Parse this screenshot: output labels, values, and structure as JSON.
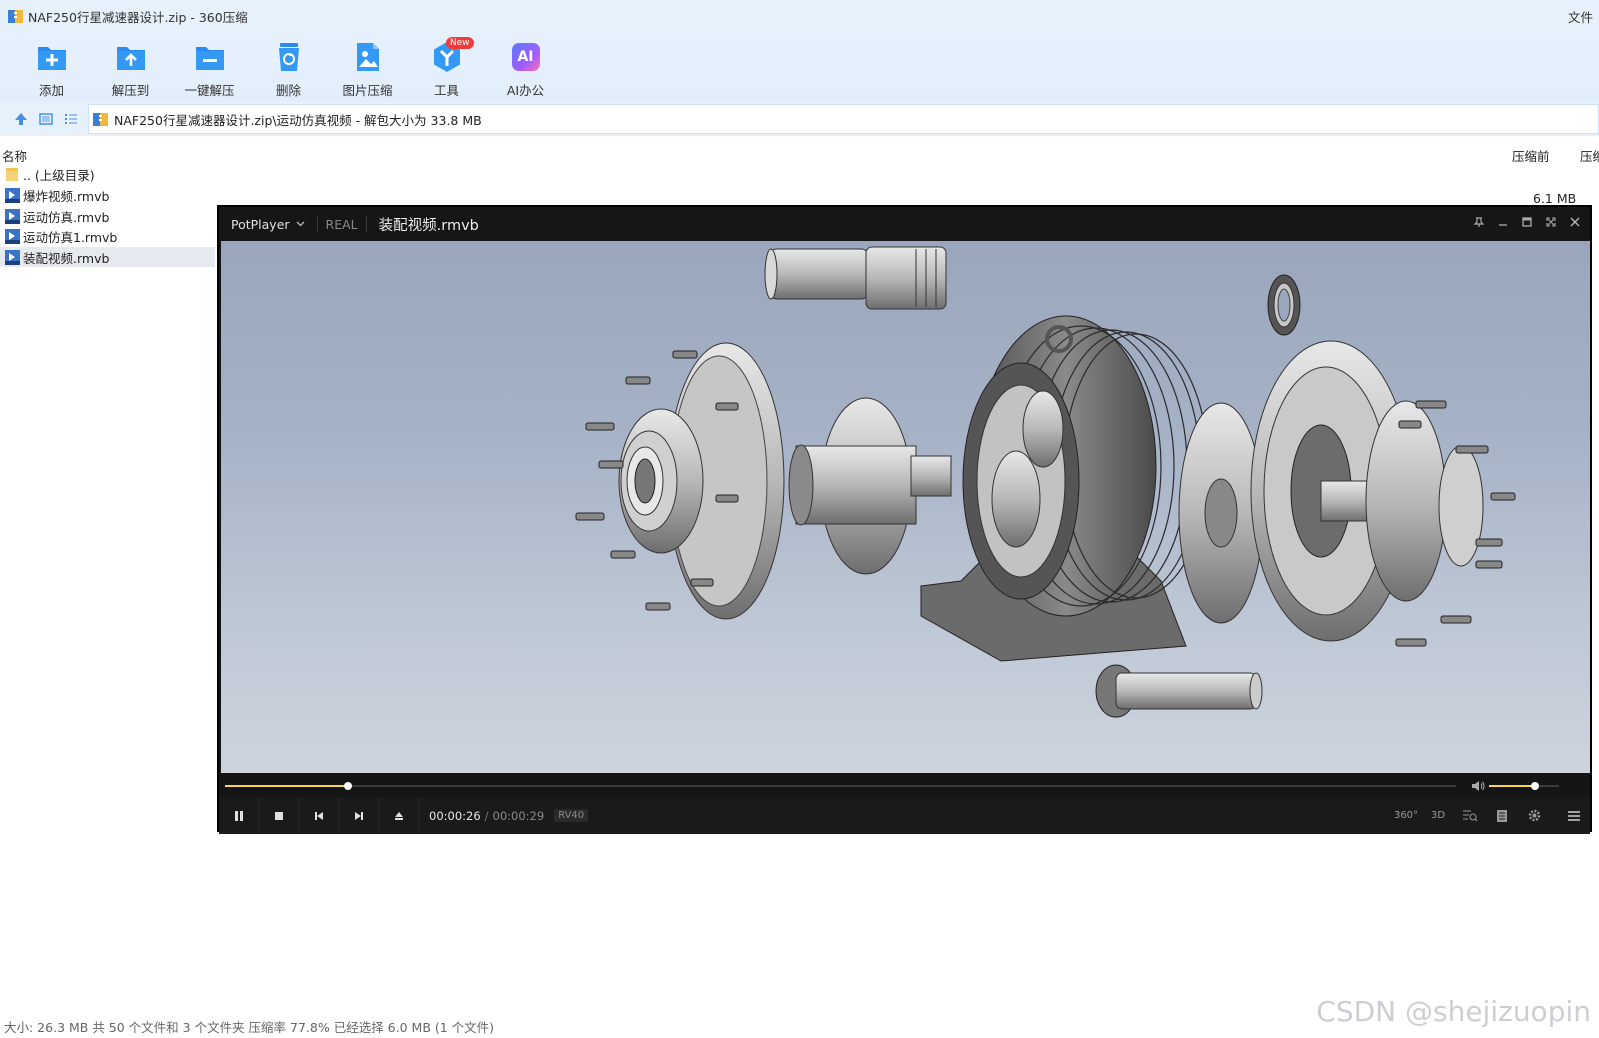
{
  "window": {
    "title": "NAF250行星减速器设计.zip - 360压缩",
    "right_menu": "文件"
  },
  "toolbar": [
    {
      "label": "添加",
      "icon": "add-icon"
    },
    {
      "label": "解压到",
      "icon": "extract-to-icon"
    },
    {
      "label": "一键解压",
      "icon": "one-click-extract-icon"
    },
    {
      "label": "删除",
      "icon": "delete-icon"
    },
    {
      "label": "图片压缩",
      "icon": "image-compress-icon"
    },
    {
      "label": "工具",
      "icon": "tools-icon",
      "badge": "New"
    },
    {
      "label": "AI办公",
      "icon": "ai-office-icon",
      "icon_text": "AI"
    }
  ],
  "address": {
    "path": "NAF250行星减速器设计.zip\\运动仿真视频 - 解包大小为 33.8 MB"
  },
  "columns": {
    "name": "名称",
    "before": "压缩前",
    "after": "压缩后"
  },
  "files": [
    {
      "name": ".. (上级目录)",
      "type": "folder"
    },
    {
      "name": "爆炸视频.rmvb",
      "type": "video",
      "size": "6.1 MB"
    },
    {
      "name": "运动仿真.rmvb",
      "type": "video"
    },
    {
      "name": "运动仿真1.rmvb",
      "type": "video"
    },
    {
      "name": "装配视频.rmvb",
      "type": "video",
      "selected": true
    }
  ],
  "status": "大小: 26.3 MB 共 50 个文件和 3 个文件夹 压缩率 77.8% 已经选择 6.0 MB (1 个文件)",
  "watermark": "CSDN @shejizuopin",
  "player": {
    "brand": "PotPlayer",
    "mode": "REAL",
    "file": "装配视频.rmvb",
    "time_current": "00:00:26",
    "time_sep": "/",
    "time_total": "00:00:29",
    "codec": "RV40",
    "progress": 0.1,
    "volume": 0.65,
    "right_buttons": {
      "b360": "360°",
      "b3d": "3D"
    },
    "accent_color": "#f5d743"
  }
}
